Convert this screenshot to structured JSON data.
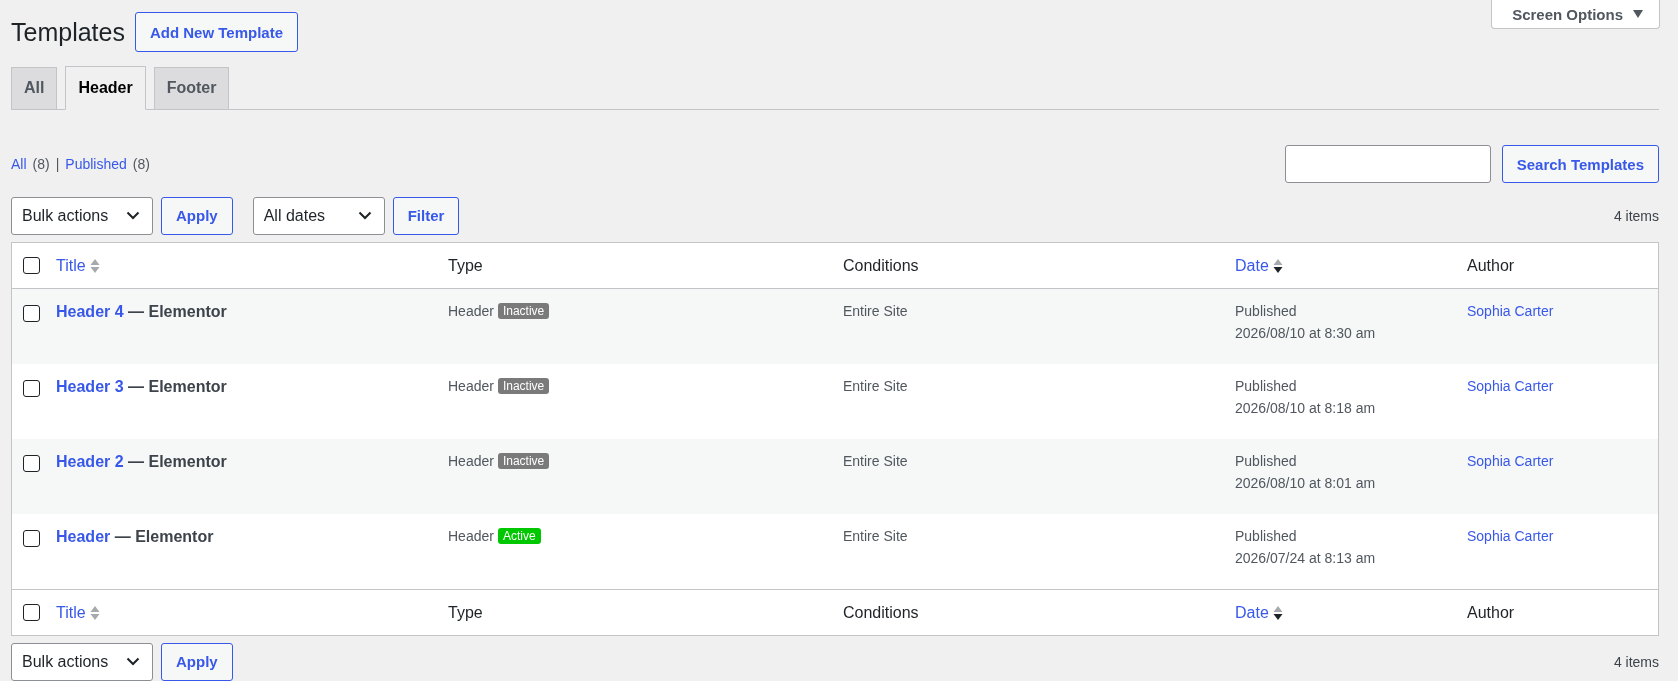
{
  "page_title": "Templates",
  "add_button": "Add New Template",
  "screen_options": "Screen Options",
  "tabs": [
    {
      "label": "All",
      "selected": false
    },
    {
      "label": "Header",
      "selected": true
    },
    {
      "label": "Footer",
      "selected": false
    }
  ],
  "views": [
    {
      "label": "All",
      "count": "(8)"
    },
    {
      "separator": "|",
      "label": "Published",
      "count": "(8)"
    }
  ],
  "search": {
    "button": "Search Templates"
  },
  "top_nav": {
    "bulk": "Bulk actions",
    "apply": "Apply",
    "dates": "All dates",
    "filter": "Filter",
    "count": "4 items"
  },
  "columns": [
    {
      "label": "Title",
      "kind": "sortable",
      "sorted": false
    },
    {
      "label": "Type",
      "kind": "plain",
      "sorted": false
    },
    {
      "label": "Conditions",
      "kind": "plain",
      "sorted": false
    },
    {
      "label": "Date",
      "kind": "sortable",
      "sorted": true
    },
    {
      "label": "Author",
      "kind": "plain",
      "sorted": false
    }
  ],
  "footer_columns": [
    {
      "label": "Title",
      "kind": "sortable",
      "sorted": false
    },
    {
      "label": "Type",
      "kind": "plain",
      "sorted": false
    },
    {
      "label": "Conditions",
      "kind": "plain",
      "sorted": false
    },
    {
      "label": "Date",
      "kind": "sortable",
      "sorted": true
    },
    {
      "label": "Author",
      "kind": "plain",
      "sorted": false
    }
  ],
  "header_checked": false,
  "rows": [
    {
      "checked": false,
      "title": "Header 4",
      "builder": "— Elementor",
      "type": "Header",
      "status": {
        "label": "Inactive",
        "active": false
      },
      "conditions": "Entire Site",
      "date_status": "Published",
      "date": "2026/08/10 at 8:30 am",
      "author": "Sophia Carter"
    },
    {
      "checked": false,
      "title": "Header 3",
      "builder": "— Elementor",
      "type": "Header",
      "status": {
        "label": "Inactive",
        "active": false
      },
      "conditions": "Entire Site",
      "date_status": "Published",
      "date": "2026/08/10 at 8:18 am",
      "author": "Sophia Carter"
    },
    {
      "checked": false,
      "title": "Header 2",
      "builder": "— Elementor",
      "type": "Header",
      "status": {
        "label": "Inactive",
        "active": false
      },
      "conditions": "Entire Site",
      "date_status": "Published",
      "date": "2026/08/10 at 8:01 am",
      "author": "Sophia Carter"
    },
    {
      "checked": false,
      "title": "Header",
      "builder": "— Elementor",
      "type": "Header",
      "status": {
        "label": "Active",
        "active": true
      },
      "conditions": "Entire Site",
      "date_status": "Published",
      "date": "2026/07/24 at 8:13 am",
      "author": "Sophia Carter"
    }
  ],
  "footer_checked": false,
  "bottom_nav": {
    "bulk": "Bulk actions",
    "apply": "Apply",
    "count": "4 items"
  }
}
